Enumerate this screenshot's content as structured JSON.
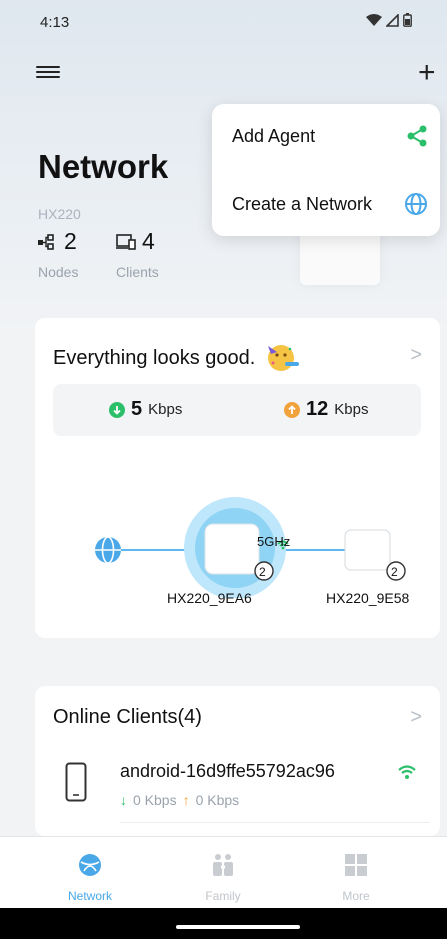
{
  "status_bar": {
    "time": "4:13"
  },
  "header": {
    "title": "Network",
    "model": "HX220",
    "nodes_count": "2",
    "nodes_label": "Nodes",
    "clients_count": "4",
    "clients_label": "Clients"
  },
  "menu": {
    "items": [
      {
        "label": "Add Agent",
        "icon": "share-icon"
      },
      {
        "label": "Create a Network",
        "icon": "globe-icon"
      }
    ]
  },
  "status_card": {
    "title": "Everything looks good.",
    "download_value": "5",
    "download_unit": "Kbps",
    "upload_value": "12",
    "upload_unit": "Kbps",
    "band_label": "5GHz",
    "main_node": {
      "name": "HX220_9EA6",
      "badge": "2"
    },
    "satellite_node": {
      "name": "HX220_9E58",
      "badge": "2"
    }
  },
  "clients_card": {
    "title": "Online Clients(4)",
    "client": {
      "name": "android-16d9ffe55792ac96",
      "down": "0 Kbps",
      "up": "0 Kbps"
    }
  },
  "nav": {
    "items": [
      {
        "label": "Network",
        "active": true
      },
      {
        "label": "Family",
        "active": false
      },
      {
        "label": "More",
        "active": false
      }
    ]
  },
  "colors": {
    "accent": "#4aa8e8",
    "green": "#2bbf6a",
    "orange": "#f2a23a"
  }
}
